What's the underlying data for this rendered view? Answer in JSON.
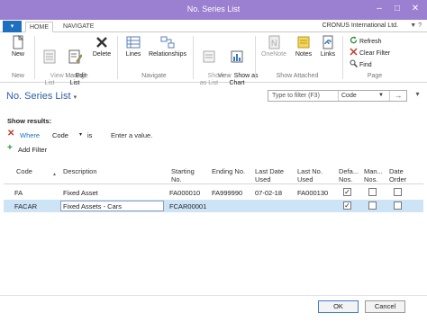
{
  "window": {
    "title": "No. Series List"
  },
  "ribbon": {
    "file_tab": "▾",
    "tabs": [
      "HOME",
      "NAVIGATE"
    ],
    "company": "CRONUS International Ltd.",
    "buttons": {
      "new": "New",
      "view_list": "View\nList",
      "edit_list": "Edit\nList",
      "delete": "Delete",
      "lines": "Lines",
      "relationships": "Relationships",
      "show_as_list": "Show\nas List",
      "show_as_chart": "Show as\nChart",
      "onenote": "OneNote",
      "notes": "Notes",
      "links": "Links",
      "refresh": "Refresh",
      "clear_filter": "Clear Filter",
      "find": "Find"
    },
    "groups": [
      "New",
      "Manage",
      "Navigate",
      "View",
      "Show Attached",
      "Page"
    ]
  },
  "page": {
    "title": "No. Series List",
    "title_arrow": "▾",
    "filter_placeholder": "Type to filter (F3)",
    "filter_field": "Code",
    "go": "→"
  },
  "filter": {
    "show_results": "Show results:",
    "where": "Where",
    "field": "Code",
    "field_arrow": "▾",
    "operator": "is",
    "value_hint": "Enter a value.",
    "add_filter": "Add Filter"
  },
  "columns": [
    "Code",
    "Description",
    "Starting\nNo.",
    "Ending No.",
    "Last Date\nUsed",
    "Last No.\nUsed",
    "Defa...\nNos.",
    "Man...\nNos.",
    "Date\nOrder"
  ],
  "rows": [
    {
      "code": "FA",
      "description": "Fixed Asset",
      "starting": "FA000010",
      "ending": "FA999990",
      "last_date": "07-02-18",
      "last_no": "FA000130",
      "default": true,
      "manual": false,
      "date_order": false
    },
    {
      "code": "FACAR",
      "description": "Fixed Assets - Cars",
      "starting": "FCAR00001",
      "ending": "",
      "last_date": "",
      "last_no": "",
      "default": true,
      "manual": false,
      "date_order": false
    }
  ],
  "footer": {
    "ok": "OK",
    "cancel": "Cancel"
  },
  "colors": {
    "titlebar": "#9b7fd0",
    "accent": "#1f6fbf",
    "selected_row": "#cde4f7"
  }
}
